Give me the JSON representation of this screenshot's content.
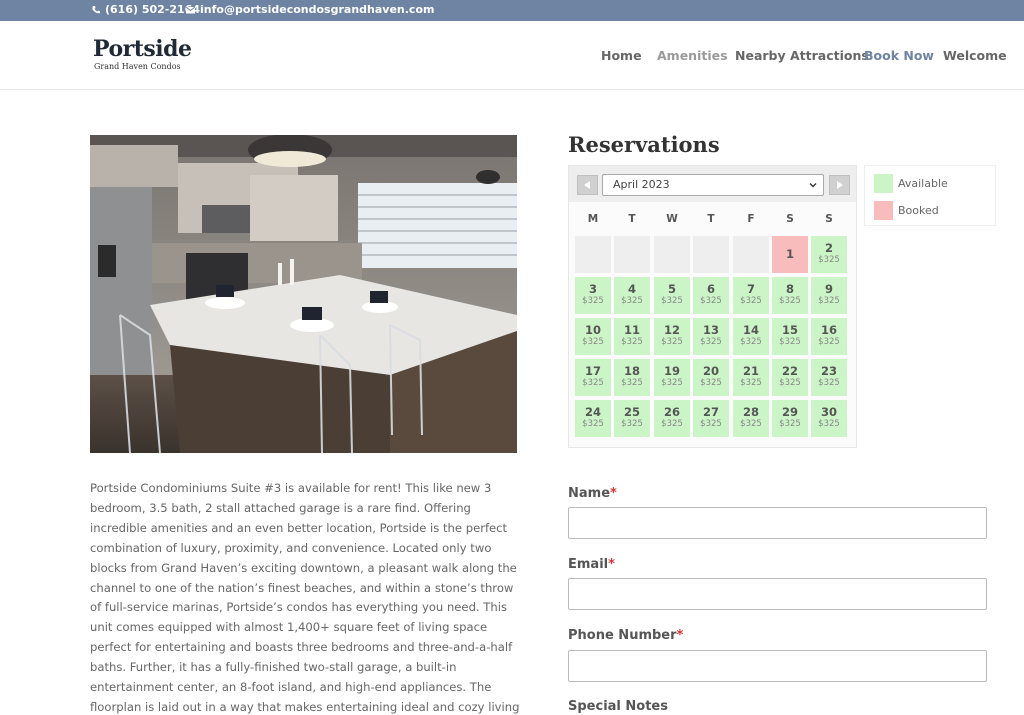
{
  "topbar": {
    "phone": "(616) 502-2164",
    "email": "info@portsidecondosgrandhaven.com",
    "phone_icon": "phone-icon",
    "email_icon": "envelope-icon",
    "bg_color": "#6f83a3"
  },
  "logo": {
    "name": "Portside",
    "tagline": "Grand Haven Condos"
  },
  "nav": [
    {
      "label": "Home"
    },
    {
      "label": "Amenities"
    },
    {
      "label": "Nearby Attractions"
    },
    {
      "label": "Book Now"
    },
    {
      "label": "Welcome"
    }
  ],
  "description": "Portside Condominiums Suite #3 is available for rent! This like new 3 bedroom, 3.5 bath, 2 stall attached garage is a rare find. Offering incredible amenities and an even better location, Portside is the perfect combination of luxury, proximity, and convenience. Located only two blocks from Grand Haven’s exciting downtown, a pleasant walk along the channel to one of the nation’s finest beaches, and within a stone’s throw of full-service marinas, Portside’s condos has everything you need. This unit comes equipped with almost 1,400+ square feet of living space perfect for entertaining and boasts three bedrooms and three-and-a-half baths. Further, it has a fully-finished two-stall garage, a built-in entertainment center, an 8-foot island, and high-end appliances. The floorplan is laid out in a way that makes entertaining ideal and cozy living a reality.",
  "reservations": {
    "title": "Reservations",
    "month": "April 2023",
    "weekdays": [
      "M",
      "T",
      "W",
      "T",
      "F",
      "S",
      "S"
    ],
    "price": "$325",
    "days": [
      {
        "day": "1",
        "status": "booked"
      },
      {
        "day": "2",
        "status": "available"
      },
      {
        "day": "3",
        "status": "available"
      },
      {
        "day": "4",
        "status": "available"
      },
      {
        "day": "5",
        "status": "available"
      },
      {
        "day": "6",
        "status": "available"
      },
      {
        "day": "7",
        "status": "available"
      },
      {
        "day": "8",
        "status": "available"
      },
      {
        "day": "9",
        "status": "available"
      },
      {
        "day": "10",
        "status": "available"
      },
      {
        "day": "11",
        "status": "available"
      },
      {
        "day": "12",
        "status": "available"
      },
      {
        "day": "13",
        "status": "available"
      },
      {
        "day": "14",
        "status": "available"
      },
      {
        "day": "15",
        "status": "available"
      },
      {
        "day": "16",
        "status": "available"
      },
      {
        "day": "17",
        "status": "available"
      },
      {
        "day": "18",
        "status": "available"
      },
      {
        "day": "19",
        "status": "available"
      },
      {
        "day": "20",
        "status": "available"
      },
      {
        "day": "21",
        "status": "available"
      },
      {
        "day": "22",
        "status": "available"
      },
      {
        "day": "23",
        "status": "available"
      },
      {
        "day": "24",
        "status": "available"
      },
      {
        "day": "25",
        "status": "available"
      },
      {
        "day": "26",
        "status": "available"
      },
      {
        "day": "27",
        "status": "available"
      },
      {
        "day": "28",
        "status": "available"
      },
      {
        "day": "29",
        "status": "available"
      },
      {
        "day": "30",
        "status": "available"
      }
    ],
    "legend": {
      "available": "Available",
      "booked": "Booked",
      "available_color": "#ccf5c7",
      "booked_color": "#f8bcbc"
    }
  },
  "form": {
    "name_label": "Name",
    "email_label": "Email",
    "phone_label": "Phone Number",
    "notes_label": "Special Notes",
    "required_mark": "*"
  }
}
